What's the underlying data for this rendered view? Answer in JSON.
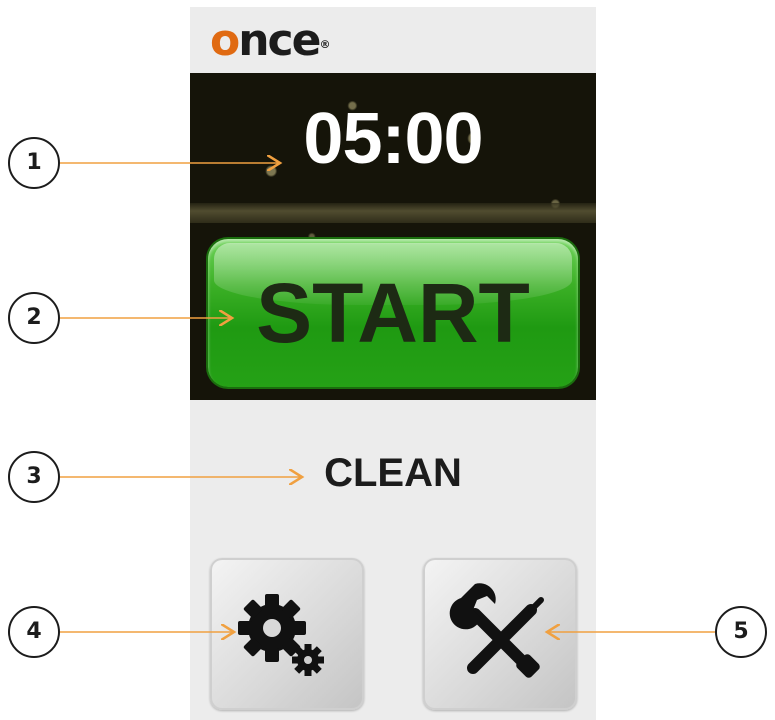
{
  "brand": {
    "logo_text_accent": "o",
    "logo_text_rest": "nce",
    "logo_mark": "®"
  },
  "timer": {
    "display": "05:00"
  },
  "start_button": {
    "label": "START"
  },
  "mode": {
    "label": "CLEAN"
  },
  "buttons": [
    {
      "name": "settings",
      "icon": "gears-icon"
    },
    {
      "name": "tools",
      "icon": "wrench-screwdriver-icon"
    }
  ],
  "callouts": [
    "1",
    "2",
    "3",
    "4",
    "5"
  ],
  "colors": {
    "accent": "#e06a12",
    "start_green": "#3db127",
    "arrow": "#f0a040",
    "dark": "#1c1c1c"
  }
}
